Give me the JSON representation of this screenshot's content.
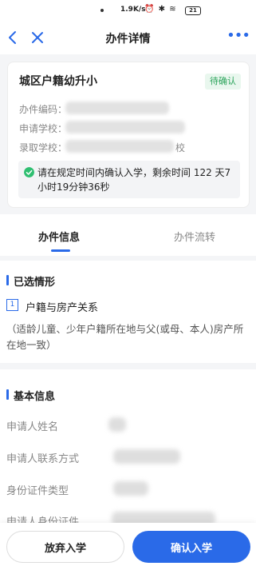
{
  "status_bar": {
    "speed": "1.9K/s",
    "icons": "⏰ ✱ ≋",
    "battery": "21"
  },
  "nav": {
    "title": "办件详情",
    "more": "•••"
  },
  "card": {
    "title": "城区户籍幼升小",
    "badge": "待确认",
    "fields": [
      {
        "label": "办件编码："
      },
      {
        "label": "申请学校："
      },
      {
        "label": "录取学校：",
        "tail": "校"
      }
    ],
    "notice": "请在规定时间内确认入学，剩余时间 122 天7小时19分钟36秒"
  },
  "tabs": {
    "info": "办件信息",
    "flow": "办件流转"
  },
  "situation": {
    "heading": "已选情形",
    "number": "1",
    "title": "户籍与房产关系",
    "description": "（适龄儿童、少年户籍所在地与父(或母、本人)房产所在地一致）"
  },
  "basic_info": {
    "heading": "基本信息",
    "rows": [
      {
        "label": "申请人姓名"
      },
      {
        "label": "申请人联系方式"
      },
      {
        "label": "身份证件类型"
      },
      {
        "label": "申请人身份证件"
      }
    ]
  },
  "actions": {
    "abandon": "放弃入学",
    "confirm": "确认入学"
  },
  "colors": {
    "accent": "#2a6ae8",
    "success": "#2fbf71"
  }
}
